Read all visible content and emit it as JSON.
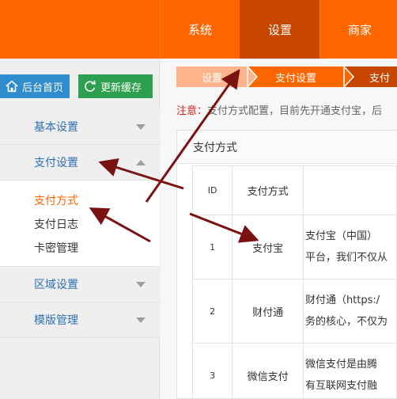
{
  "header": {
    "nav": [
      {
        "label": "系统",
        "active": false
      },
      {
        "label": "设置",
        "active": true
      },
      {
        "label": "商家",
        "active": false
      }
    ]
  },
  "sidebar": {
    "home_label": "后台首页",
    "refresh_label": "更新缓存",
    "sections": [
      {
        "label": "基本设置",
        "expanded": false
      },
      {
        "label": "支付设置",
        "expanded": true,
        "items": [
          "支付方式",
          "支付日志",
          "卡密管理"
        ]
      },
      {
        "label": "区域设置",
        "expanded": false
      },
      {
        "label": "模版管理",
        "expanded": false
      }
    ]
  },
  "breadcrumbs": [
    "设置",
    "支付设置",
    "支付"
  ],
  "notice": {
    "label": "注意：",
    "text": "支付方式配置，目前先开通支付宝，后"
  },
  "panel": {
    "title": "支付方式",
    "columns": [
      "ID",
      "支付方式",
      ""
    ],
    "rows": [
      {
        "id": "1",
        "method": "支付宝",
        "desc1": "支付宝（中国）",
        "desc2": "平台，我们不仅从"
      },
      {
        "id": "2",
        "method": "财付通",
        "desc1": "财付通（https:/",
        "desc2": "务的核心，不仅为"
      },
      {
        "id": "3",
        "method": "微信支付",
        "desc1": "微信支付是由腾",
        "desc2": "有互联网支付融"
      }
    ]
  },
  "colors": {
    "header": "#ff6600",
    "header_active": "#c74700",
    "home_button": "#2f8ccd",
    "refresh_button": "#2ca04e",
    "annotation_arrow": "#7a1212"
  }
}
